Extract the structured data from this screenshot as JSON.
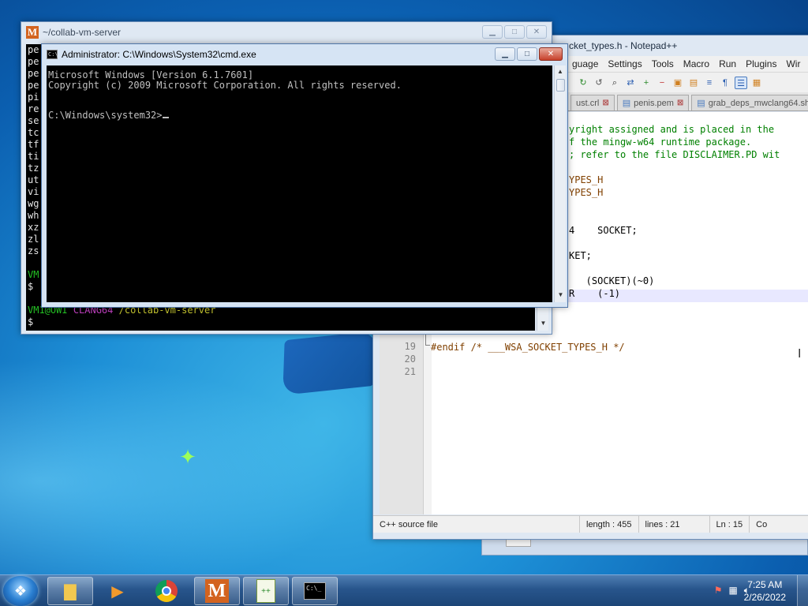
{
  "mintty": {
    "title": "~/collab-vm-server",
    "icon_letter": "M",
    "left_lines": [
      "pe",
      "pe",
      "pe",
      "pe",
      "pi",
      "re",
      "se",
      "tc",
      "tf",
      "ti",
      "tz",
      "ut",
      "vi",
      "wg",
      "wh",
      "xz",
      "zl",
      "zs"
    ],
    "prompt1_user": "VM",
    "prompt1_dollar": "$",
    "prompt2_user": "VM1@OWI",
    "prompt2_env": "CLANG64",
    "prompt2_path": "/collab-vm-server",
    "prompt2_dollar": "$"
  },
  "npp": {
    "title": "cket_types.h - Notepad++",
    "menu": [
      "guage",
      "Settings",
      "Tools",
      "Macro",
      "Run",
      "Plugins",
      "Wir"
    ],
    "tabs": [
      {
        "label": "ust.crl"
      },
      {
        "label": "penis.pem"
      },
      {
        "label": "grab_deps_mwclang64.sh"
      }
    ],
    "code_lines": [
      {
        "text": "yright assigned and is placed in the",
        "color": "#008000"
      },
      {
        "text": "f the mingw-w64 runtime package.",
        "color": "#008000"
      },
      {
        "text": "; refer to the file DISCLAIMER.PD wit",
        "color": "#008000"
      },
      {
        "text": "",
        "color": "#000"
      },
      {
        "text": "YPES_H",
        "color": "#804000"
      },
      {
        "text": "YPES_H",
        "color": "#804000"
      },
      {
        "text": "",
        "color": "#000"
      },
      {
        "text": "",
        "color": "#000"
      },
      {
        "text": "4    SOCKET;",
        "color": "#000"
      },
      {
        "text": "",
        "color": "#000"
      },
      {
        "text": "KET;",
        "color": "#000"
      },
      {
        "text": "",
        "color": "#000"
      },
      {
        "text": "   (SOCKET)(~0)",
        "color": "#000"
      },
      {
        "text": "R    (-1)",
        "color": "#000"
      }
    ],
    "line_numbers": [
      "19",
      "20",
      "21"
    ],
    "endif_line": "#endif /* ___WSA_SOCKET_TYPES_H */",
    "status": {
      "lang": "C++ source file",
      "length": "length : 455",
      "lines": "lines : 21",
      "pos": "Ln : 15",
      "col": "Co"
    }
  },
  "cmd": {
    "title": "Administrator: C:\\Windows\\System32\\cmd.exe",
    "icon_text": "C:\\",
    "lines": [
      "Microsoft Windows [Version 6.1.7601]",
      "Copyright (c) 2009 Microsoft Corporation.  All rights reserved.",
      "",
      "C:\\Windows\\system32>"
    ]
  },
  "taskbar": {
    "time": "7:25 AM",
    "date": "2/26/2022",
    "apps": [
      {
        "name": "explorer",
        "icon": "folder-icon"
      },
      {
        "name": "media player",
        "icon": "media-player-icon"
      },
      {
        "name": "chrome",
        "icon": "chrome-icon"
      },
      {
        "name": "mintty",
        "icon": "mintty-icon"
      },
      {
        "name": "notepad++",
        "icon": "notepad-plus-plus-icon"
      },
      {
        "name": "cmd",
        "icon": "cmd-icon"
      }
    ]
  }
}
